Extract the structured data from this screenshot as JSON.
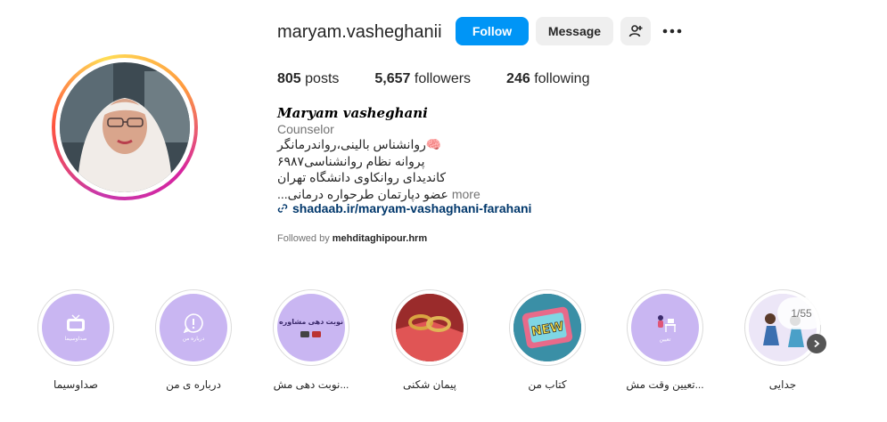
{
  "profile": {
    "username": "maryam.vasheghanii",
    "follow_label": "Follow",
    "message_label": "Message",
    "full_name": "Maryam vasheghani",
    "category": "Counselor",
    "bio_lines": [
      "🧠روانشناس بالینی،رواندرمانگر",
      "پروانه نظام روانشناسی۶۹۸۷",
      "کاندیدای روانکاوی دانشگاه تهران",
      "عضو دپارتمان طرحواره درمانی..."
    ],
    "more_label": "more",
    "link": "shadaab.ir/maryam-vashaghani-farahani",
    "followed_by_prefix": "Followed by ",
    "followed_by_user": "mehditaghipour.hrm"
  },
  "stats": {
    "posts_count": "805",
    "posts_label": "posts",
    "followers_count": "5,657",
    "followers_label": "followers",
    "following_count": "246",
    "following_label": "following"
  },
  "highlights": [
    {
      "label": "صداوسیما",
      "thumb_text": "صداوسیما",
      "icon": "tv-icon"
    },
    {
      "label": "درباره ی من",
      "thumb_text": "درباره من",
      "icon": "chat-info-icon"
    },
    {
      "label": "نوبت دهی مش...",
      "thumb_text": "نوبت دهی مشاوره",
      "icon": "phone-icon"
    },
    {
      "label": "پیمان شکنی",
      "thumb_text": "",
      "icon": "broken-rings-image"
    },
    {
      "label": "کتاب من",
      "thumb_text": "",
      "icon": "new-tv-image"
    },
    {
      "label": "تعیین وقت مش...",
      "thumb_text": "تعیین",
      "icon": "desk-person-icon"
    },
    {
      "label": "جدایی",
      "thumb_text": "",
      "icon": "separation-image"
    }
  ],
  "pager": {
    "text": "1/55"
  },
  "colors": {
    "follow": "#0095f6",
    "highlight_bg": "#c9b6f2",
    "link": "#00376b"
  }
}
